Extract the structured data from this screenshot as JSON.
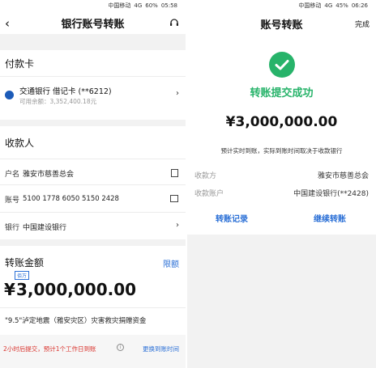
{
  "left": {
    "status": {
      "carrier": "中国移动",
      "signal": "4G",
      "battery": "60%",
      "time": "05:58"
    },
    "title": "银行账号转账",
    "pay_card": {
      "section_title": "付款卡",
      "bank_name": "交通银行 借记卡 (**6212)",
      "balance": "可用余额：3,352,400.18元"
    },
    "payee": {
      "section_title": "收款人",
      "name_label": "户名",
      "name_value": "雅安市慈善总会",
      "account_label": "账号",
      "account_value": "5100 1778 6050 5150 2428",
      "bank_label": "银行",
      "bank_value": "中国建设银行"
    },
    "amount": {
      "section_title": "转账金额",
      "limit_link": "限额",
      "unit_badge": "佰万",
      "currency": "¥",
      "value": "3,000,000.00",
      "memo": "\"9.5\"泸定地震（雅安灾区）灾害救灾捐赠资金"
    },
    "footer": {
      "notice": "2小时后提交，预计1个工作日到账",
      "info_icon": "info-icon",
      "change_link": "更换到账时间"
    },
    "colors": {
      "accent": "#2a6fd6",
      "notice_red": "#d9322c"
    }
  },
  "right": {
    "status": {
      "carrier": "中国移动",
      "signal": "4G",
      "battery": "45%",
      "time": "06:26"
    },
    "title": "账号转账",
    "done": "完成",
    "success_text": "转账提交成功",
    "amount": "¥3,000,000.00",
    "note": "预计实时到账，实际到账时间取决于收款银行",
    "payee_label": "收款方",
    "payee_value": "雅安市慈善总会",
    "account_label": "收款账户",
    "account_value": "中国建设银行(**2428)",
    "btn_records": "转账记录",
    "btn_continue": "继续转账",
    "colors": {
      "success": "#27b36a",
      "accent": "#2a6fd6"
    }
  }
}
